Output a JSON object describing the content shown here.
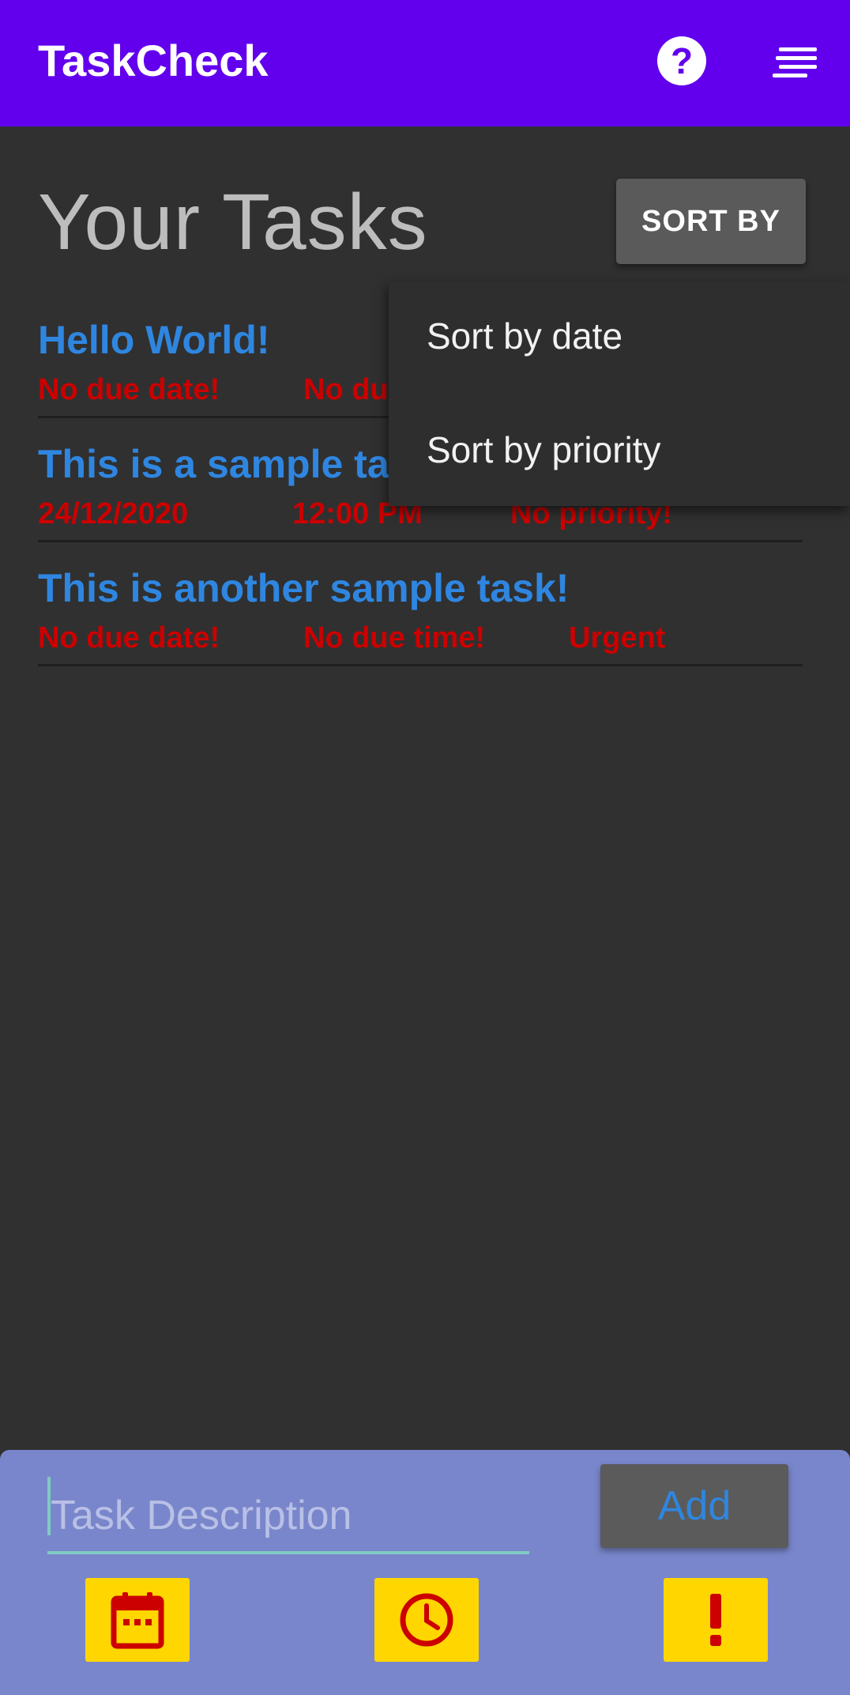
{
  "appbar": {
    "title": "TaskCheck",
    "help_icon": "help-circle-icon",
    "menu_icon": "sort-lines-icon",
    "color": "#6200EE"
  },
  "header": {
    "title": "Your Tasks",
    "sort_label": "SORT BY"
  },
  "tasks": [
    {
      "title": "Hello World!",
      "date": "No due date!",
      "time": "No due time!",
      "priority": ""
    },
    {
      "title": "This is a sample task!",
      "date": "24/12/2020",
      "time": "12:00 PM",
      "priority": "No priority!"
    },
    {
      "title": "This is another sample task!",
      "date": "No due date!",
      "time": "No due time!",
      "priority": "Urgent"
    }
  ],
  "sort_menu": {
    "items": [
      "Sort by date",
      "Sort by priority"
    ]
  },
  "input": {
    "placeholder": "Task Description",
    "value": ""
  },
  "add_button": "Add",
  "toolbar": {
    "icons": [
      "calendar-icon",
      "clock-icon",
      "exclamation-icon"
    ]
  },
  "colors": {
    "background": "#303030",
    "task_title": "#2f86e0",
    "task_meta": "#cc0000",
    "bottom_panel": "#7986CB",
    "tool_button": "#FFD600"
  }
}
